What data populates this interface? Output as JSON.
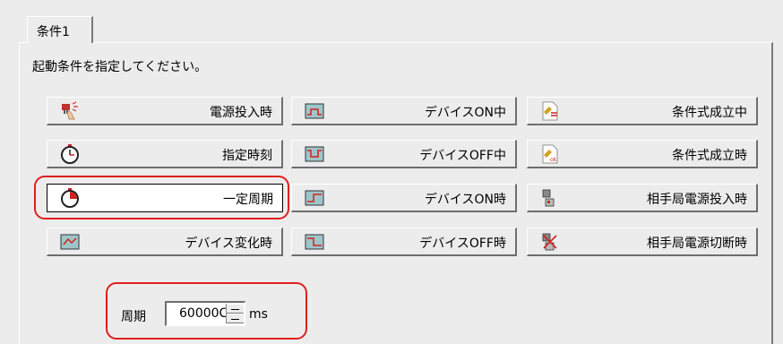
{
  "tab": {
    "label": "条件1"
  },
  "instruction": "起動条件を指定してください。",
  "buttons": {
    "power_on": {
      "label": "電源投入時",
      "icon": "power-plug-icon"
    },
    "device_on_during": {
      "label": "デバイスON中",
      "icon": "device-on-during-icon"
    },
    "condition_true_during": {
      "label": "条件式成立中",
      "icon": "condition-during-icon"
    },
    "specified_time": {
      "label": "指定時刻",
      "icon": "stopwatch-icon"
    },
    "device_off_during": {
      "label": "デバイスOFF中",
      "icon": "device-off-during-icon"
    },
    "condition_true_when": {
      "label": "条件式成立時",
      "icon": "condition-ok-icon"
    },
    "fixed_period": {
      "label": "一定周期",
      "icon": "stopwatch-icon",
      "selected": true
    },
    "device_on_when": {
      "label": "デバイスON時",
      "icon": "device-on-edge-icon"
    },
    "remote_power_on": {
      "label": "相手局電源投入時",
      "icon": "remote-power-on-icon"
    },
    "device_change": {
      "label": "デバイス変化時",
      "icon": "device-change-icon"
    },
    "device_off_when": {
      "label": "デバイスOFF時",
      "icon": "device-off-edge-icon"
    },
    "remote_power_off": {
      "label": "相手局電源切断時",
      "icon": "remote-power-off-icon"
    }
  },
  "period": {
    "label": "周期",
    "value": "60000C",
    "unit": "ms"
  },
  "colors": {
    "highlight": "#e01e1e",
    "background": "#ececec"
  }
}
